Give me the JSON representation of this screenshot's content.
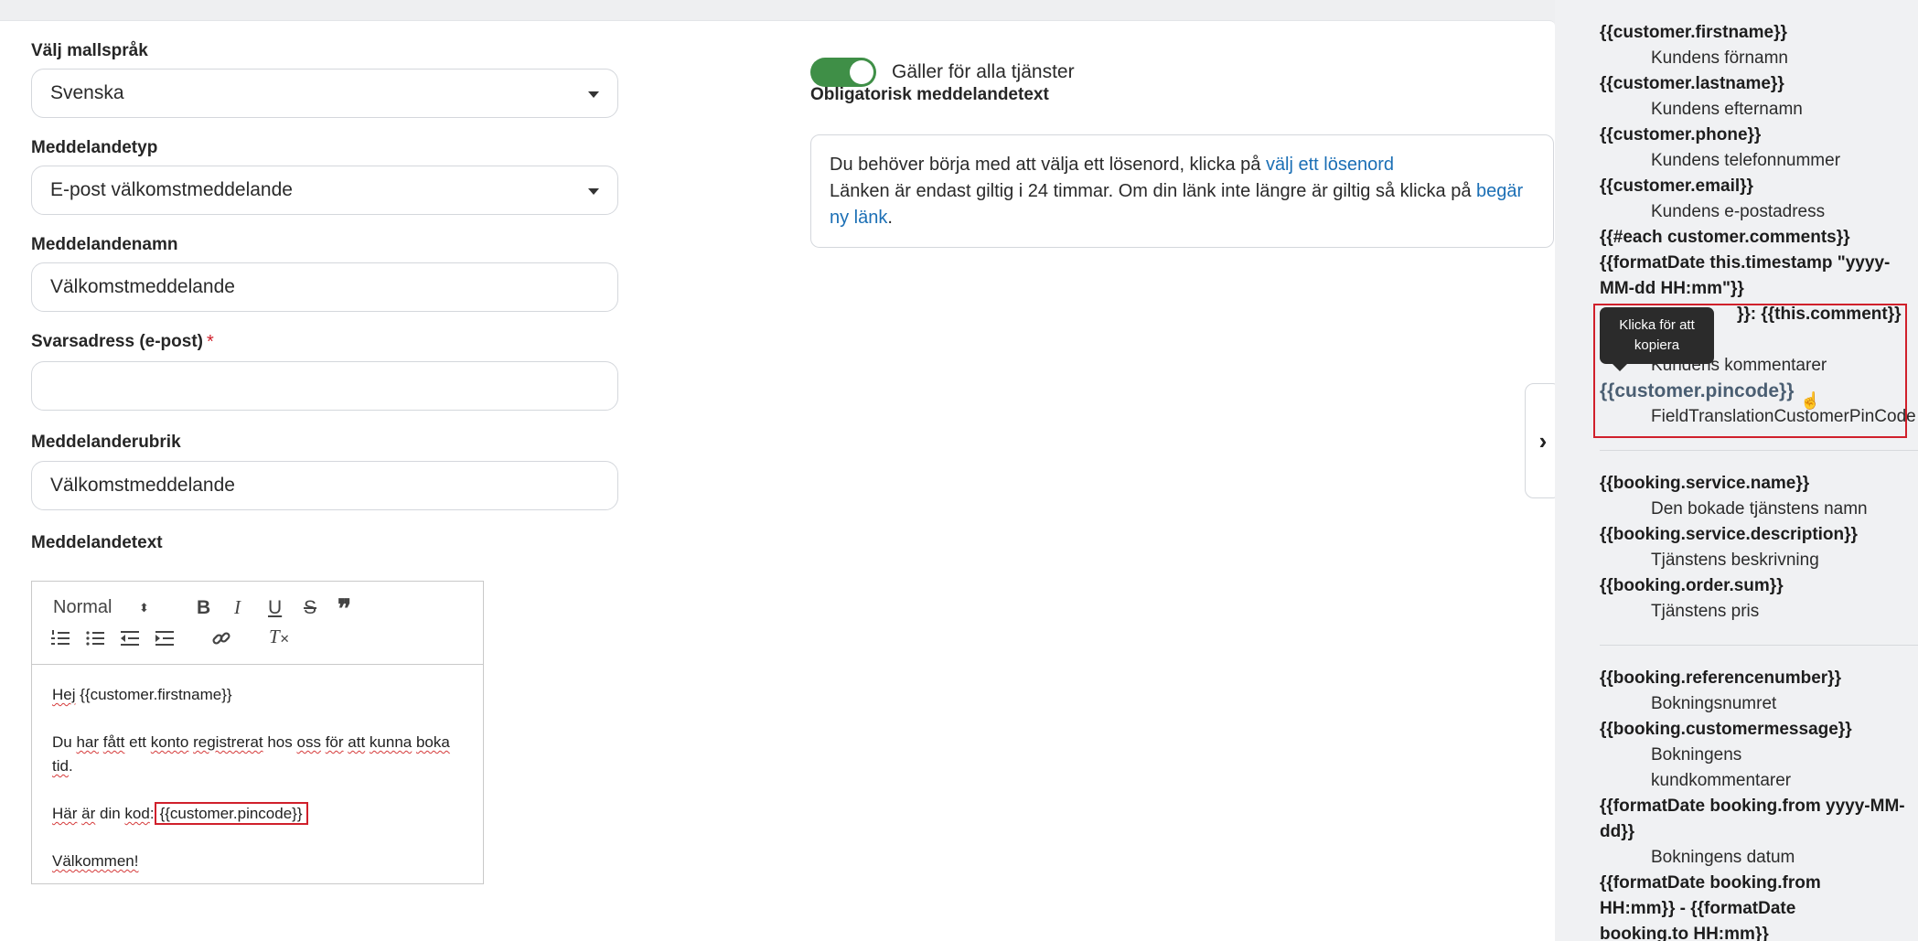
{
  "form": {
    "language_label": "Välj mallspråk",
    "language_value": "Svenska",
    "type_label": "Meddelandetyp",
    "type_value": "E-post välkomstmeddelande",
    "name_label": "Meddelandenamn",
    "name_value": "Välkomstmeddelande",
    "reply_label": "Svarsadress (e-post)",
    "reply_required": "*",
    "reply_value": "",
    "subject_label": "Meddelanderubrik",
    "subject_value": "Välkomstmeddelande",
    "text_label": "Meddelandetext"
  },
  "editor": {
    "format_select": "Normal",
    "body": {
      "line1_a": "Hej",
      "line1_b": " {{customer.firstname}}",
      "line2_a": "Du ",
      "line2_w1": "har",
      "line2_b": " ",
      "line2_w2": "fått",
      "line2_c": " ett ",
      "line2_w3": "konto",
      "line2_d": " ",
      "line2_w4": "registrerat",
      "line2_e": " hos ",
      "line2_w5": "oss",
      "line2_f": " ",
      "line2_w6": "för",
      "line2_g": " ",
      "line2_w7": "att",
      "line2_h": " ",
      "line2_w8": "kunna",
      "line2_i": " ",
      "line2_w9": "boka",
      "line2_j": " ",
      "line2_w10": "tid",
      "line2_k": ".",
      "line3_w1": "Här",
      "line3_a": " ",
      "line3_w2": "är",
      "line3_b": " din ",
      "line3_w3": "kod",
      "line3_c": ":",
      "line3_tag": "{{customer.pincode}}",
      "line4": "Välkommen!"
    }
  },
  "settings": {
    "toggle_label": "Gäller för alla tjänster",
    "toggle_on": true,
    "mandatory_label": "Obligatorisk meddelandetext",
    "mandatory_t1": "Du behöver börja med att välja ett lösenord, klicka på ",
    "mandatory_link1": "välj ett lösenord",
    "mandatory_t2": "Länken är endast giltig i 24 timmar. Om din länk inte längre är giltig så klicka på ",
    "mandatory_link2": "begär ny länk",
    "mandatory_t3": "."
  },
  "panel": {
    "tooltip": "Klicka för att kopiera",
    "group1": [
      {
        "tag": "{{customer.firstname}}",
        "desc": "Kundens förnamn"
      },
      {
        "tag": "{{customer.lastname}}",
        "desc": "Kundens efternamn"
      },
      {
        "tag": "{{customer.phone}}",
        "desc": "Kundens telefonnummer"
      },
      {
        "tag": "{{customer.email}}",
        "desc": "Kundens e-postadress"
      }
    ],
    "comments_tag_1": "{{#each customer.comments}}",
    "comments_tag_2": "{{formatDate this.timestamp \"yyyy-MM-dd HH:mm\"}}",
    "comments_tag_3": "}}: {{this.comment}}",
    "comments_desc": "Kundens kommentarer",
    "pincode_tag": "{{customer.pincode}}",
    "pincode_desc": "FieldTranslationCustomerPinCode",
    "group2": [
      {
        "tag": "{{booking.service.name}}",
        "desc": "Den bokade tjänstens namn"
      },
      {
        "tag": "{{booking.service.description}}",
        "desc": "Tjänstens beskrivning"
      },
      {
        "tag": "{{booking.order.sum}}",
        "desc": "Tjänstens pris"
      }
    ],
    "group3": [
      {
        "tag": "{{booking.referencenumber}}",
        "desc": "Bokningsnumret"
      },
      {
        "tag": "{{booking.customermessage}}",
        "desc": "Bokningens kundkommentarer"
      },
      {
        "tag": "{{formatDate booking.from yyyy-MM-dd}}",
        "desc": "Bokningens datum"
      },
      {
        "tag": "{{formatDate booking.from HH:mm}} - {{formatDate booking.to HH:mm}}",
        "desc": ""
      }
    ]
  },
  "colors": {
    "accent_green": "#3f8f47",
    "link_blue": "#1b6fb5",
    "highlight_red": "#d0202b"
  }
}
